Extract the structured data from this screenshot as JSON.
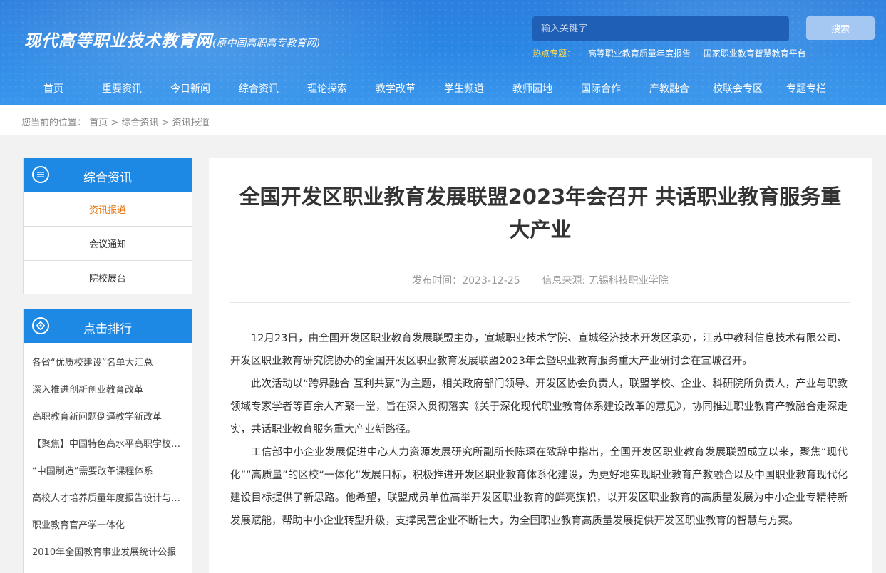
{
  "header": {
    "logo_main": "现代高等职业技术教育网",
    "logo_sub": "(原中国高职高专教育网)",
    "search_placeholder": "输入关键字",
    "search_button": "搜索",
    "hot_label": "热点专题：",
    "hot_links": [
      "高等职业教育质量年度报告",
      "国家职业教育智慧教育平台"
    ]
  },
  "nav": [
    "首页",
    "重要资讯",
    "今日新闻",
    "综合资讯",
    "理论探索",
    "教学改革",
    "学生频道",
    "教师园地",
    "国际合作",
    "产教融合",
    "校联会专区",
    "专题专栏"
  ],
  "breadcrumb": {
    "prefix": "您当前的位置：",
    "items": [
      "首页",
      "综合资讯",
      "资讯报道"
    ],
    "sep": ">"
  },
  "sidebar": {
    "category_title": "综合资讯",
    "categories": [
      "资讯报道",
      "会议通知",
      "院校展台"
    ],
    "ranking_title": "点击排行",
    "ranking": [
      "各省“优质校建设”名单大汇总",
      "深入推进创新创业教育改革",
      "高职教育新问题倒逼教学新改革",
      "【聚焦】中国特色高水平高职学校和专业建设计划",
      "“中国制造”需要改革课程体系",
      "高校人才培养质量年度报告设计与编制",
      "职业教育官产学一体化",
      "2010年全国教育事业发展统计公报"
    ]
  },
  "article": {
    "title": "全国开发区职业教育发展联盟2023年会召开 共话职业教育服务重大产业",
    "publish_label": "发布时间：",
    "publish_date": "2023-12-25",
    "source_label": "信息来源:",
    "source": "无锡科技职业学院",
    "paragraphs": [
      "12月23日，由全国开发区职业教育发展联盟主办，宣城职业技术学院、宣城经济技术开发区承办，江苏中教科信息技术有限公司、开发区职业教育研究院协办的全国开发区职业教育发展联盟2023年会暨职业教育服务重大产业研讨会在宣城召开。",
      "此次活动以“跨界融合 互利共赢”为主题，相关政府部门领导、开发区协会负责人，联盟学校、企业、科研院所负责人，产业与职教领域专家学者等百余人齐聚一堂，旨在深入贯彻落实《关于深化现代职业教育体系建设改革的意见》，协同推进职业教育产教融合走深走实，共话职业教育服务重大产业新路径。",
      "工信部中小企业发展促进中心人力资源发展研究所副所长陈琛在致辞中指出，全国开发区职业教育发展联盟成立以来，聚焦“现代化”“高质量”的区校“一体化”发展目标，积极推进开发区职业教育体系化建设，为更好地实现职业教育产教融合以及中国职业教育现代化建设目标提供了新思路。他希望，联盟成员单位高举开发区职业教育的鲜亮旗帜，以开发区职业教育的高质量发展为中小企业专精特新发展赋能，帮助中小企业转型升级，支撑民营企业不断壮大，为全国职业教育高质量发展提供开发区职业教育的智慧与方案。"
    ]
  },
  "colors": {
    "header_blue": "#2a86e4",
    "sidebar_blue": "#1e88e5",
    "active_orange": "#e8710a",
    "hot_yellow": "#ffd84a"
  }
}
